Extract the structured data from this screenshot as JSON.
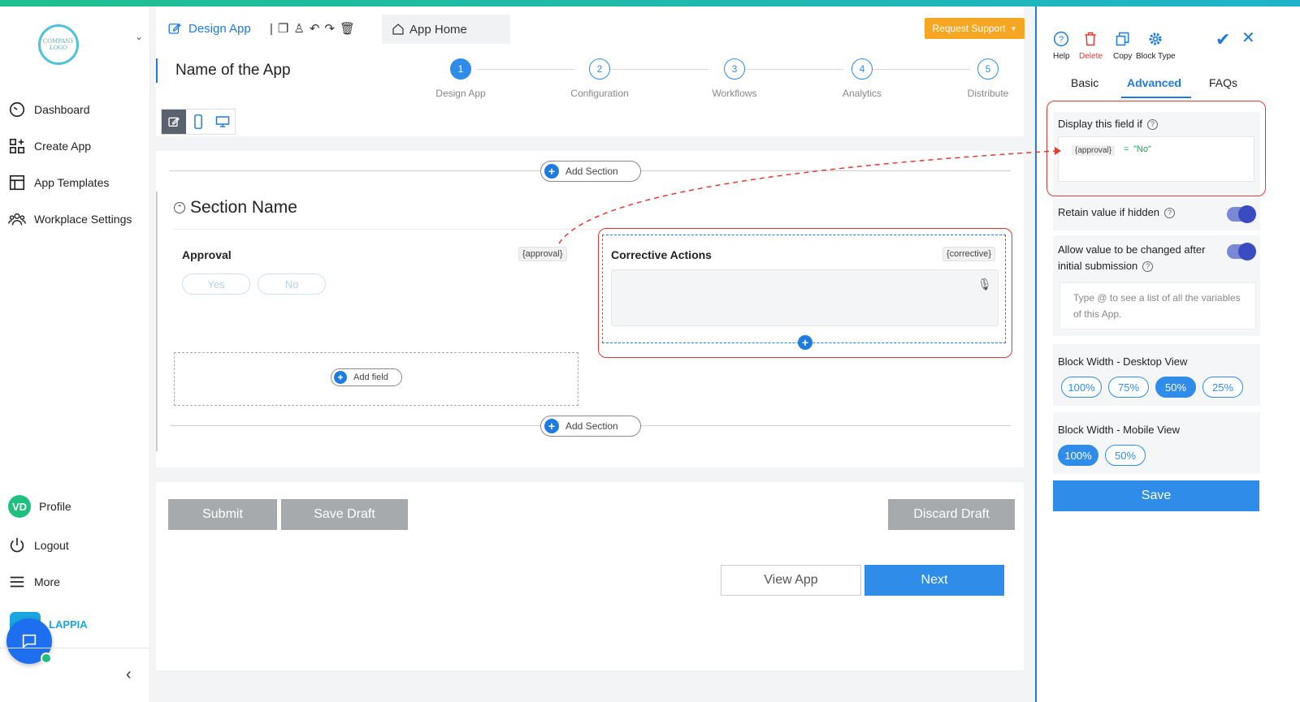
{
  "sidebar": {
    "logo_text": "COMPANY LOGO",
    "items": [
      {
        "label": "Dashboard",
        "icon": "gauge-icon"
      },
      {
        "label": "Create App",
        "icon": "grid-plus-icon"
      },
      {
        "label": "App Templates",
        "icon": "layout-icon"
      },
      {
        "label": "Workplace Settings",
        "icon": "users-icon"
      }
    ],
    "bottom": [
      {
        "label": "Profile",
        "avatar": "VD"
      },
      {
        "label": "Logout",
        "icon": "power-icon"
      },
      {
        "label": "More",
        "icon": "menu-icon"
      }
    ],
    "brand": "LAPPIA"
  },
  "header": {
    "design_tab": "Design App",
    "app_home": "App Home",
    "request_support": "Request Support",
    "app_name": "Name of the App"
  },
  "steps": [
    {
      "num": "1",
      "label": "Design App"
    },
    {
      "num": "2",
      "label": "Configuration"
    },
    {
      "num": "3",
      "label": "Workflows"
    },
    {
      "num": "4",
      "label": "Analytics"
    },
    {
      "num": "5",
      "label": "Distribute"
    }
  ],
  "canvas": {
    "add_section": "Add Section",
    "section_name": "Section Name",
    "approval_label": "Approval",
    "approval_var": "{approval}",
    "yes": "Yes",
    "no": "No",
    "corrective_label": "Corrective Actions",
    "corrective_var": "{corrective}",
    "add_field": "Add field"
  },
  "actions": {
    "submit": "Submit",
    "save_draft": "Save Draft",
    "discard_draft": "Discard Draft",
    "view_app": "View App",
    "next": "Next"
  },
  "panel": {
    "tools": [
      "Help",
      "Delete",
      "Copy",
      "Block Type"
    ],
    "tabs": [
      "Basic",
      "Advanced",
      "FAQs"
    ],
    "display_if_label": "Display this field if",
    "condition_var": "{approval}",
    "condition_op": "=",
    "condition_value": "\"No\"",
    "retain_label": "Retain value if hidden",
    "allow_change_label": "Allow value to be changed after initial submission",
    "hint": "Type @ to see a list of all the variables of this App.",
    "desktop_width_label": "Block Width - Desktop View",
    "desktop_options": [
      "100%",
      "75%",
      "50%",
      "25%"
    ],
    "desktop_selected": "50%",
    "mobile_width_label": "Block Width - Mobile View",
    "mobile_options": [
      "100%",
      "50%"
    ],
    "mobile_selected": "100%",
    "save": "Save"
  },
  "colors": {
    "accent": "#2f8ce8",
    "highlight": "#e53935",
    "support": "#f5a623"
  }
}
